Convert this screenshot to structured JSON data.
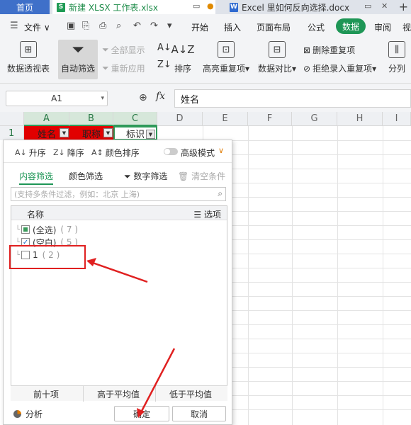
{
  "tabs": {
    "home": "首页",
    "xlsx": "新建 XLSX 工作表.xlsx",
    "docx": "Excel 里如何反向选择.docx"
  },
  "menu": {
    "file": "文件",
    "items": [
      "开始",
      "插入",
      "页面布局",
      "公式",
      "数据",
      "审阅",
      "视"
    ],
    "active": "数据"
  },
  "ribbon": {
    "pivot": "数据透视表",
    "autofilter": "自动筛选",
    "show_all": "全部显示",
    "reapply": "重新应用",
    "sort": "排序",
    "highlight_dup": "高亮重复项",
    "compare": "数据对比",
    "remove_dup": "删除重复项",
    "reject_dup": "拒绝录入重复项",
    "split": "分列"
  },
  "formula_bar": {
    "cell_ref": "A1",
    "fx": "fx",
    "content": "姓名"
  },
  "grid": {
    "columns": [
      "A",
      "B",
      "C",
      "D",
      "E",
      "F",
      "G",
      "H",
      "I"
    ],
    "row1": "1",
    "cells": [
      "姓名",
      "职称",
      "标识"
    ]
  },
  "filter_popup": {
    "asc": "升序",
    "desc": "降序",
    "color_sort": "颜色排序",
    "advanced": "高级模式",
    "tab_content": "内容筛选",
    "tab_color": "颜色筛选",
    "number_filter": "数字筛选",
    "clear_cond": "清空条件",
    "search_placeholder": "(支持多条件过滤，例如：北京 上海)",
    "list_header": "名称",
    "options": "选项",
    "items": [
      {
        "label": "(全选)",
        "count": "( 7 )"
      },
      {
        "label": "(空白)",
        "count": "( 5 )"
      },
      {
        "label": "1",
        "count": "( 2 )"
      }
    ],
    "top10": "前十项",
    "above_avg": "高于平均值",
    "below_avg": "低于平均值",
    "analysis": "分析",
    "ok": "确定",
    "cancel": "取消"
  },
  "colors": {
    "accent": "#1e9656",
    "header_red": "#e10000",
    "annotation": "#e02020"
  }
}
